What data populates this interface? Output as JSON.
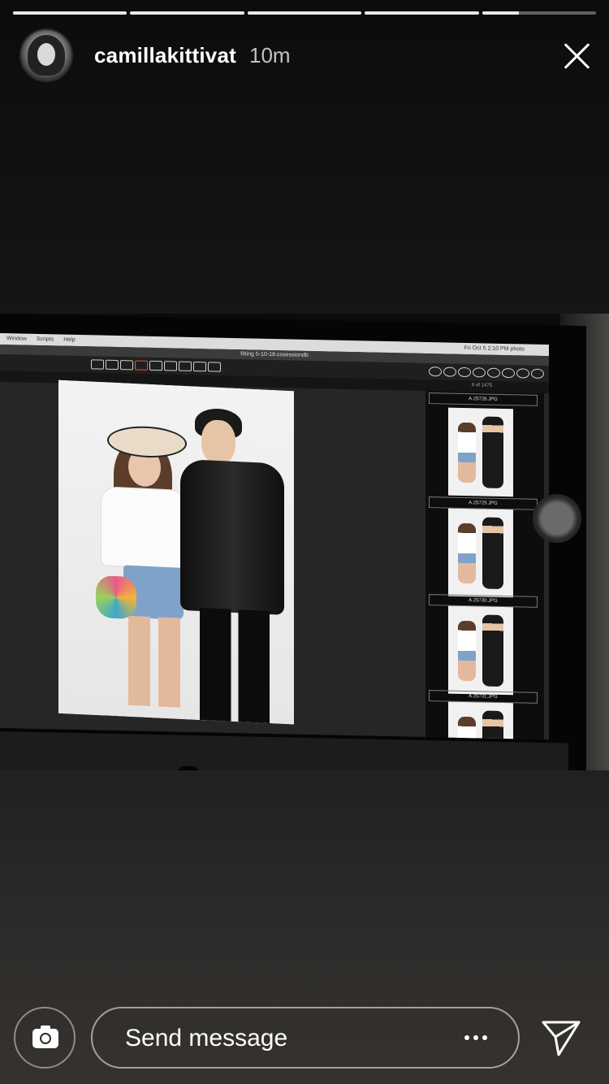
{
  "story": {
    "progress_segments": [
      1,
      1,
      1,
      1,
      0.32
    ],
    "username": "camillakittivat",
    "time_ago": "10m"
  },
  "icons": {
    "close": "close-icon",
    "camera": "camera-icon",
    "more": "more-dots-icon",
    "send": "send-icon"
  },
  "photo_screen": {
    "menu_items": [
      "Window",
      "Scripts",
      "Help"
    ],
    "menubar_status": "Fri Oct 5  2:10 PM   photo",
    "session_title": "fitting 5-10-18.cosessiondb",
    "image_count": "6 of 1475",
    "film_labels": [
      "A.25728.JPG",
      "A.25729.JPG",
      "A.25730.JPG",
      "A.25731.JPG"
    ]
  },
  "composer": {
    "placeholder": "Send message"
  },
  "colors": {
    "progress_active": "#e8e8e8",
    "progress_inactive": "rgba(255,255,255,0.35)",
    "text": "#ffffff"
  }
}
